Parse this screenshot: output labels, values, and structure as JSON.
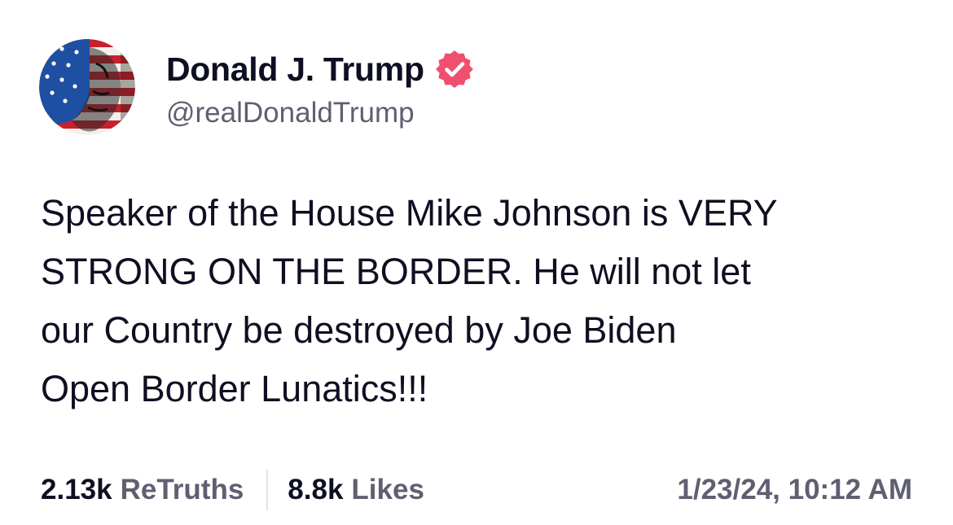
{
  "author": {
    "display_name": "Donald J. Trump",
    "handle": "@realDonaldTrump",
    "verified": true
  },
  "post": {
    "text_lines": [
      "Speaker of the House Mike Johnson is VERY",
      "STRONG ON THE BORDER. He will not let",
      "our Country be destroyed by Joe Biden",
      "Open Border Lunatics!!!"
    ]
  },
  "stats": {
    "retruths_count": "2.13k",
    "retruths_label": "ReTruths",
    "likes_count": "8.8k",
    "likes_label": "Likes"
  },
  "timestamp": "1/23/24, 10:12 AM",
  "colors": {
    "text_primary": "#0f0f23",
    "text_secondary": "#5f5f72",
    "verified_badge": "#f0506e",
    "divider": "#e3e3ea"
  },
  "icons": {
    "avatar": "flag-portrait-avatar",
    "verified": "verified-badge-icon"
  }
}
